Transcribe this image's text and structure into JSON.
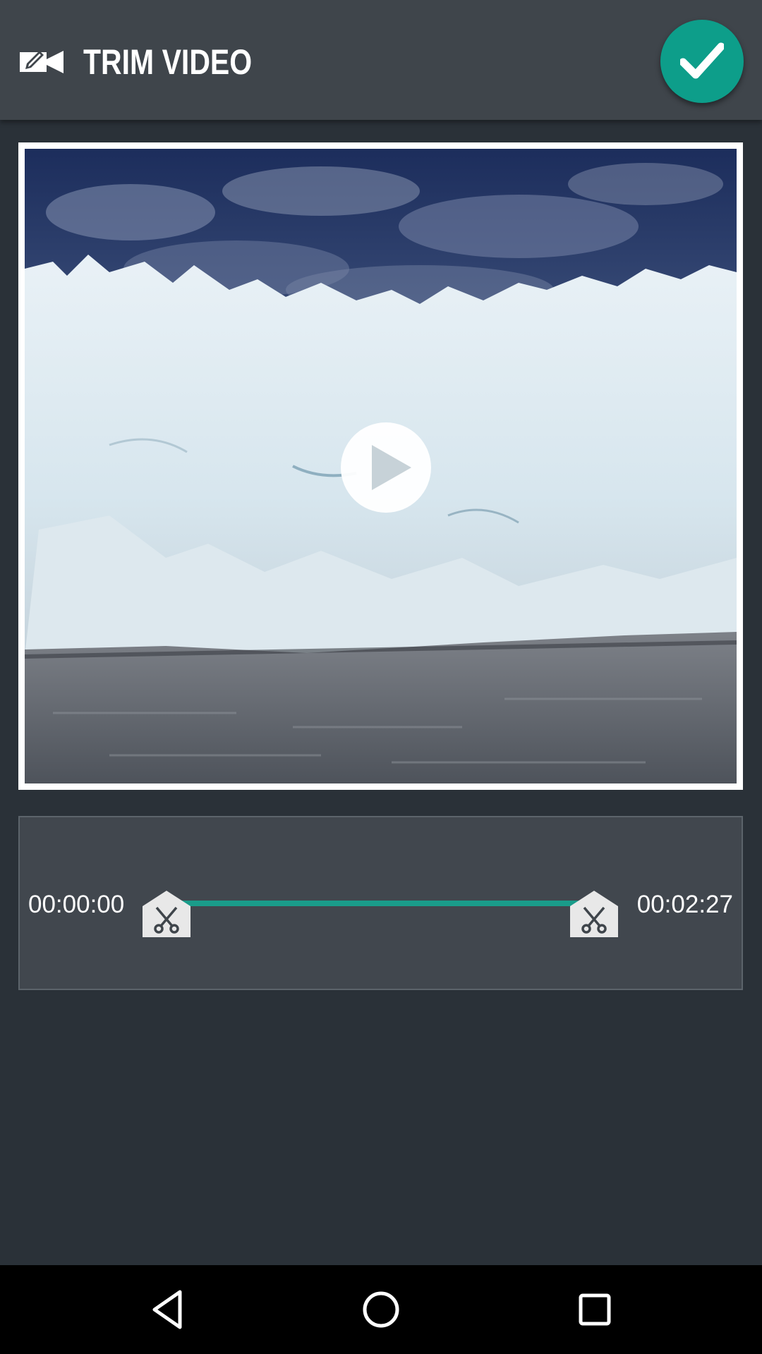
{
  "app_bar": {
    "title": "TRIM VIDEO",
    "icon": "video-edit-icon",
    "confirm_icon": "checkmark-icon",
    "accent_color": "#0d9e8a"
  },
  "player": {
    "play_icon": "play-icon"
  },
  "trim": {
    "start_time": "00:00:00",
    "end_time": "00:02:27",
    "start_handle_icon": "scissors-icon",
    "end_handle_icon": "scissors-icon",
    "track_color": "#1a9c8a"
  },
  "nav_bar": {
    "back_icon": "back-triangle-icon",
    "home_icon": "home-circle-icon",
    "recents_icon": "recents-square-icon"
  }
}
